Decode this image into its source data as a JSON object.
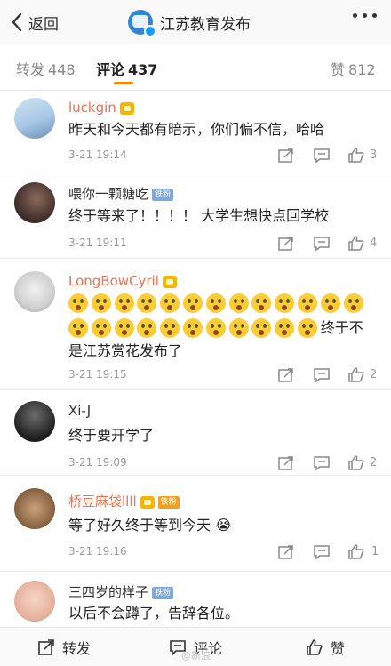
{
  "header": {
    "back_label": "返回",
    "title": "江苏教育发布"
  },
  "tabs": {
    "repost_label": "转发",
    "repost_count": "448",
    "comment_label": "评论",
    "comment_count": "437",
    "like_label": "赞",
    "like_count": "812"
  },
  "comments": [
    {
      "user": "luckgin",
      "text": "昨天和今天都有暗示，你们偏不信，哈哈",
      "time": "3-21 19:14",
      "likes": "3"
    },
    {
      "user": "喂你一颗糖吃",
      "badge": "铁粉",
      "text": "终于等来了！！！！ 大学生想快点回学校",
      "time": "3-21 19:11",
      "likes": "4"
    },
    {
      "user": "LongBowCyril",
      "text_tail": "终于不",
      "text_line2": "是江苏赏花发布了",
      "emoji_count": 23,
      "time": "3-21 19:15",
      "likes": "2"
    },
    {
      "user": "Xi-J",
      "text": "终于要开学了",
      "time": "3-21 19:09",
      "likes": "2"
    },
    {
      "user": "桥豆麻袋llll",
      "badge": "铁粉",
      "text": "等了好久终于等到今天 😭",
      "time": "3-21 19:16",
      "likes": "1"
    },
    {
      "user": "三四岁的样子",
      "badge": "铁粉",
      "text": "以后不会蹲了，告辞各位。"
    }
  ],
  "bottombar": {
    "repost_label": "转发",
    "comment_label": "评论",
    "like_label": "赞"
  },
  "watermark": "@新浪",
  "icons": [
    "chevron-left-icon",
    "more-dots-icon",
    "share-icon",
    "comment-icon",
    "thumb-up-icon"
  ],
  "colors": {
    "accent": "#ff8200",
    "vip_name": "#eb7350",
    "muted": "#999999"
  }
}
